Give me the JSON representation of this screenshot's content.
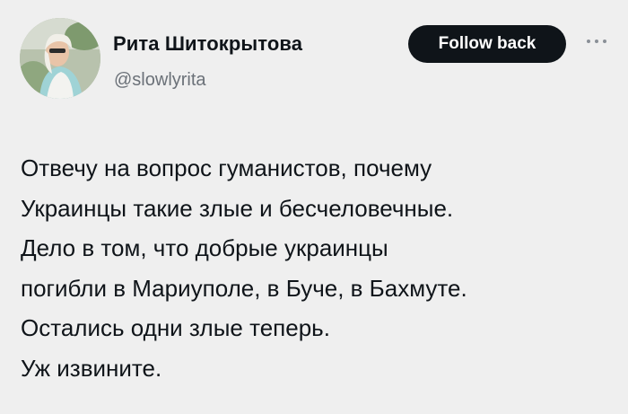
{
  "tweet": {
    "author": {
      "display_name": "Рита Шитокрытова",
      "handle": "@slowlyrita"
    },
    "follow_button_label": "Follow back",
    "more_icon": "more-horizontal-icon",
    "text_lines": [
      "Отвечу на вопрос гуманистов, почему",
      "Украинцы такие злые и бесчеловечные.",
      "Дело в том, что добрые украинцы",
      "погибли в Мариуполе, в Буче, в Бахмуте.",
      "Остались одни злые теперь.",
      "Уж извините."
    ]
  },
  "colors": {
    "background": "#efefef",
    "text": "#0f1419",
    "secondary_text": "#6b7178",
    "button_background": "#0f1419",
    "button_text": "#ffffff"
  }
}
